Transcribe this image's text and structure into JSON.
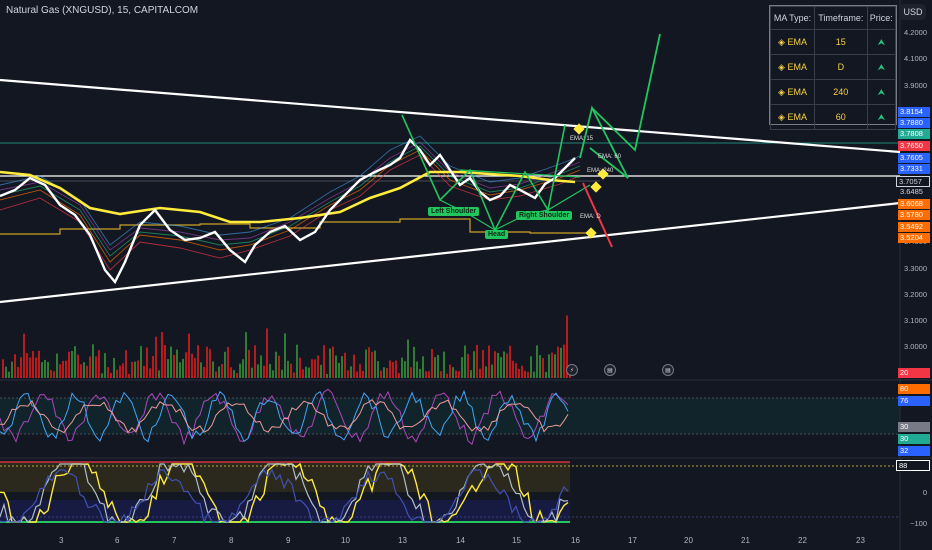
{
  "header": {
    "title": "Natural Gas (XNGUSD), 15, CAPITALCOM",
    "currency": "USD"
  },
  "legend": {
    "headers": [
      "MA Type:",
      "Timeframe:",
      "Price:"
    ],
    "rows": [
      {
        "type": "EMA",
        "timeframe": "15",
        "price": "up-arrow-icon"
      },
      {
        "type": "EMA",
        "timeframe": "D",
        "price": "up-arrow-icon"
      },
      {
        "type": "EMA",
        "timeframe": "240",
        "price": "up-arrow-icon"
      },
      {
        "type": "EMA",
        "timeframe": "60",
        "price": "up-arrow-icon"
      }
    ]
  },
  "price_axis": {
    "labels": [
      "4.2000",
      "4.1000",
      "3.9000",
      "3.4000",
      "3.3000",
      "3.2000",
      "3.1000",
      "3.0000"
    ],
    "tags": [
      {
        "text": "3.8154",
        "color": "#2962ff"
      },
      {
        "text": "3.7880",
        "color": "#2962ff"
      },
      {
        "text": "3.7808",
        "color": "#22ab94"
      },
      {
        "text": "3.7650",
        "color": "#f23645"
      },
      {
        "text": "3.7605",
        "color": "#2962ff"
      },
      {
        "text": "3.7331",
        "color": "#2962ff"
      },
      {
        "text": "3.7057",
        "color": "#131722"
      },
      {
        "text": "3.6485",
        "color": "#131722"
      },
      {
        "text": "3.6068",
        "color": "#ff6d00"
      },
      {
        "text": "3.5780",
        "color": "#ff6d00"
      },
      {
        "text": "3.5492",
        "color": "#ff6d00"
      },
      {
        "text": "3.5204",
        "color": "#ff6d00"
      }
    ]
  },
  "osc_axis": {
    "rsi_tags": [
      {
        "text": "20",
        "color": "#f23645"
      },
      {
        "text": "80",
        "color": "#ff6d00"
      },
      {
        "text": "76",
        "color": "#2962ff"
      },
      {
        "text": "30",
        "color": "#787b86"
      },
      {
        "text": "30",
        "color": "#22ab94"
      },
      {
        "text": "32",
        "color": "#2962ff"
      }
    ],
    "stoch_labels": [
      "88",
      "0",
      "−100"
    ]
  },
  "time_axis": [
    "3",
    "6",
    "7",
    "8",
    "9",
    "10",
    "13",
    "14",
    "15",
    "16",
    "17",
    "20",
    "21",
    "22",
    "23"
  ],
  "pattern_labels": {
    "left_shoulder": "Left Shoulder",
    "head": "Head",
    "right_shoulder": "Right Shoulder"
  },
  "ema_tags": [
    "EMA: 15",
    "EMA: 60",
    "EMA: 240",
    "EMA: D"
  ],
  "colors": {
    "background": "#131722",
    "pattern": "#22c55e",
    "projection_up": "#22c55e",
    "projection_down": "#f23645",
    "ema_fast": "#ffeb3b",
    "trendline": "#ffffff"
  }
}
